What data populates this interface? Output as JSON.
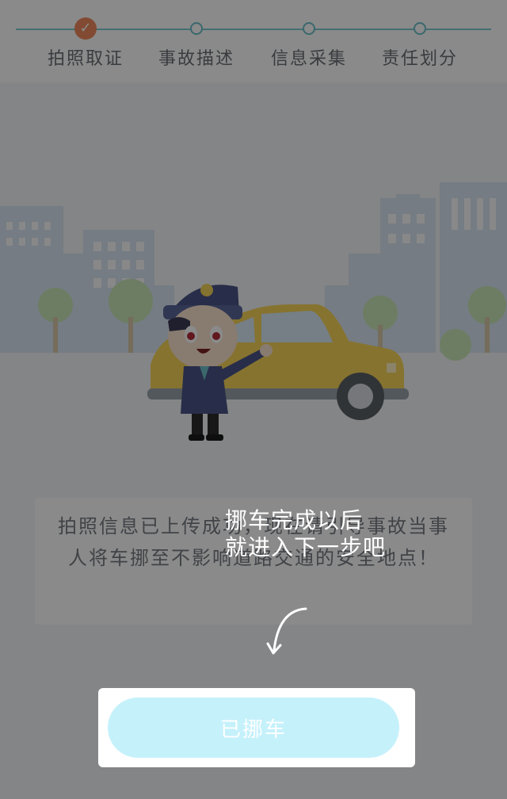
{
  "stepper": {
    "steps": [
      {
        "label": "拍照取证",
        "state": "done"
      },
      {
        "label": "事故描述",
        "state": "pending"
      },
      {
        "label": "信息采集",
        "state": "pending"
      },
      {
        "label": "责任划分",
        "state": "pending"
      }
    ],
    "done_icon": "check-icon"
  },
  "message": {
    "text": "拍照信息已上传成功，现在请引导事故当事人将车挪至不影响道路交通的安全地点！"
  },
  "tip": {
    "line1": "挪车完成以后",
    "line2": "就进入下一步吧",
    "arrow_icon": "curved-arrow-icon"
  },
  "action": {
    "button_label": "已挪车"
  },
  "colors": {
    "step_line": "#7ccbd3",
    "step_done": "#f08a5d",
    "button_bg": "#c5f1fb",
    "overlay": "rgba(0,0,0,0.46)"
  }
}
